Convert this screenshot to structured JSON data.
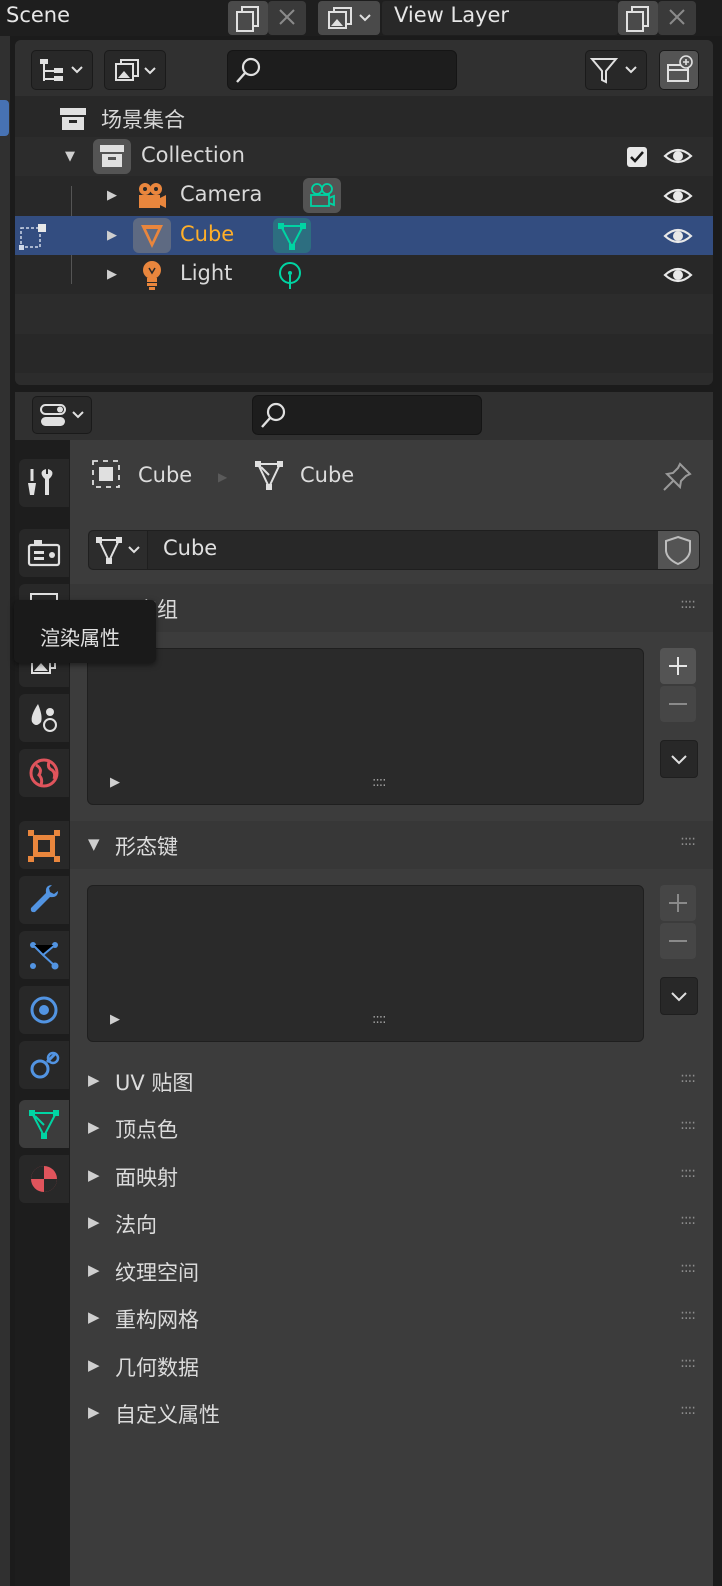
{
  "topbar": {
    "scene": "Scene",
    "view_layer": "View Layer"
  },
  "outliner": {
    "scene_collection": "场景集合",
    "rows": [
      {
        "label": "Collection"
      },
      {
        "label": "Camera"
      },
      {
        "label": "Cube"
      },
      {
        "label": "Light"
      }
    ]
  },
  "properties": {
    "breadcrumb": {
      "object": "Cube",
      "mesh": "Cube"
    },
    "datablock_name": "Cube",
    "tooltip": "渲染属性",
    "panels": {
      "vertex_groups": "顶点组",
      "shape_keys": "形态键"
    },
    "collapsed_panels": [
      "UV 贴图",
      "顶点色",
      "面映射",
      "法向",
      "纹理空间",
      "重构网格",
      "几何数据",
      "自定义属性"
    ],
    "grip": "::::",
    "list_grip": "::::"
  },
  "colors": {
    "selected_row": "#334d80",
    "selected_text": "#ffaf29",
    "mesh_data": "#00d4a3",
    "object_orange": "#e9863d",
    "modifier_blue": "#5294e2",
    "render_red": "#e0545c"
  }
}
